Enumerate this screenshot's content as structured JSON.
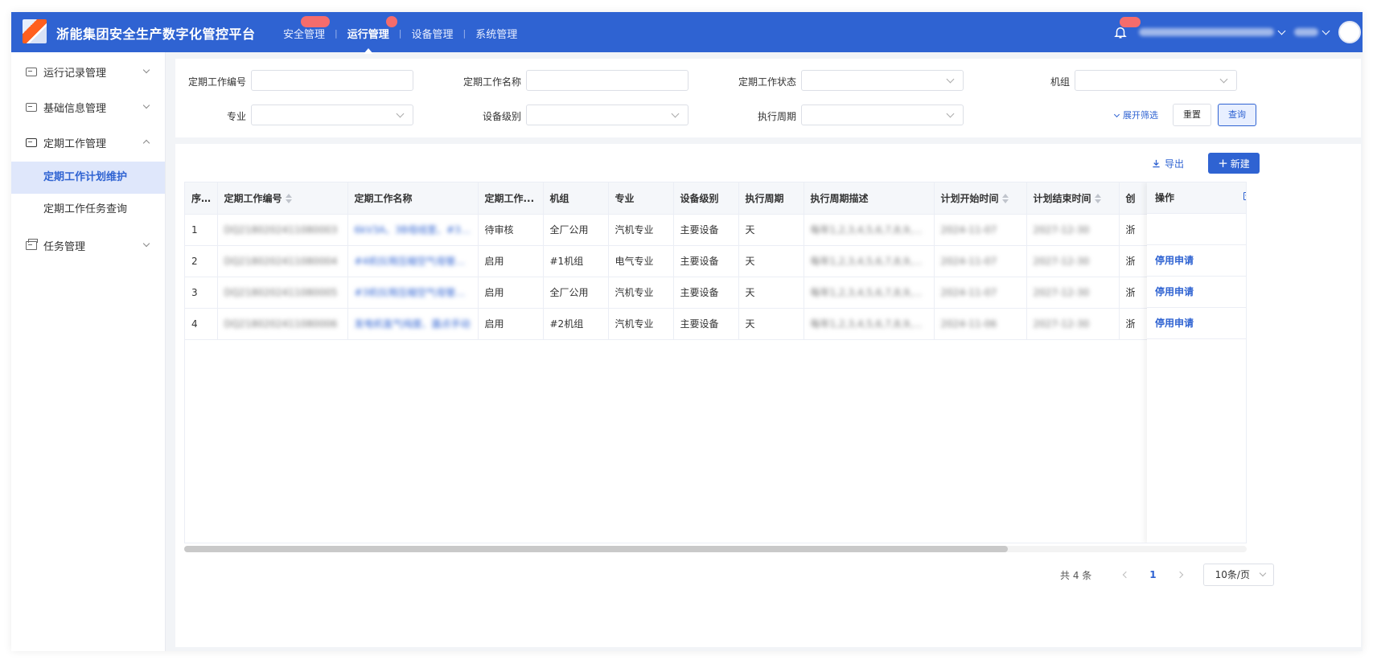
{
  "app": {
    "title": "浙能集团安全生产数字化管控平台"
  },
  "topnav": [
    {
      "label": "安全管理",
      "active": false
    },
    {
      "label": "运行管理",
      "active": true
    },
    {
      "label": "设备管理",
      "active": false
    },
    {
      "label": "系统管理",
      "active": false
    }
  ],
  "sidebar": {
    "items": [
      {
        "label": "运行记录管理"
      },
      {
        "label": "基础信息管理"
      },
      {
        "label": "定期工作管理"
      },
      {
        "label": "任务管理"
      }
    ],
    "sub_items": [
      {
        "label": "定期工作计划维护",
        "active": true
      },
      {
        "label": "定期工作任务查询",
        "active": false
      }
    ]
  },
  "filters": {
    "code_label": "定期工作编号",
    "name_label": "定期工作名称",
    "status_label": "定期工作状态",
    "unit_label": "机组",
    "specialty_label": "专业",
    "level_label": "设备级别",
    "cycle_label": "执行周期",
    "expand": "展开筛选",
    "reset": "重置",
    "query": "查询"
  },
  "toolbar": {
    "export": "导出",
    "new": "新建"
  },
  "table": {
    "columns": [
      "序号",
      "定期工作编号",
      "定期工作名称",
      "定期工作...",
      "机组",
      "专业",
      "设备级别",
      "执行周期",
      "执行周期描述",
      "计划开始时间",
      "计划结束时间",
      "创"
    ],
    "op_header": "操作",
    "rows": [
      {
        "idx": "1",
        "code": "DQ2180202411080003",
        "name": "6kV3A、3B母线室、#3机组",
        "status": "待审核",
        "unit": "全厂公用",
        "specialty": "汽机专业",
        "level": "主要设备",
        "cycle": "天",
        "cycle_desc": "每年1,2,3,4,5,6,7,8,9,10,",
        "start": "2024-11-07",
        "end": "2027-12-30",
        "creator": "浙",
        "op": ""
      },
      {
        "idx": "2",
        "code": "DQ2180202411080004",
        "name": "#4机仪用压缩空气母管放水",
        "status": "启用",
        "unit": "#1机组",
        "specialty": "电气专业",
        "level": "主要设备",
        "cycle": "天",
        "cycle_desc": "每年1,2,3,4,5,6,7,8,9,10,",
        "start": "2024-11-07",
        "end": "2027-12-30",
        "creator": "浙",
        "op": "停用申请"
      },
      {
        "idx": "3",
        "code": "DQ2180202411080005",
        "name": "#3机仪用压缩空气母管放水",
        "status": "启用",
        "unit": "全厂公用",
        "specialty": "汽机专业",
        "level": "主要设备",
        "cycle": "天",
        "cycle_desc": "每年1,2,3,4,5,6,7,8,9,10,",
        "start": "2024-11-07",
        "end": "2027-12-30",
        "creator": "浙",
        "op": "停用申请"
      },
      {
        "idx": "4",
        "code": "DQ2180202411080006",
        "name": "发电机氢气纯度、露点手动",
        "status": "启用",
        "unit": "#2机组",
        "specialty": "汽机专业",
        "level": "主要设备",
        "cycle": "天",
        "cycle_desc": "每年1,2,3,4,5,6,7,8,9,10,",
        "start": "2024-11-06",
        "end": "2027-12-30",
        "creator": "浙",
        "op": "停用申请"
      }
    ]
  },
  "pagination": {
    "total": "共 4 条",
    "page": "1",
    "size": "10条/页"
  },
  "colors": {
    "primary": "#2f63d2",
    "badge": "#f56c6c",
    "active_bg": "#dfe7fb"
  },
  "icons": [
    "logo-icon",
    "bell-icon",
    "avatar",
    "record-icon",
    "info-icon",
    "schedule-icon",
    "task-icon",
    "download-icon",
    "plus-icon",
    "column-settings-icon"
  ]
}
